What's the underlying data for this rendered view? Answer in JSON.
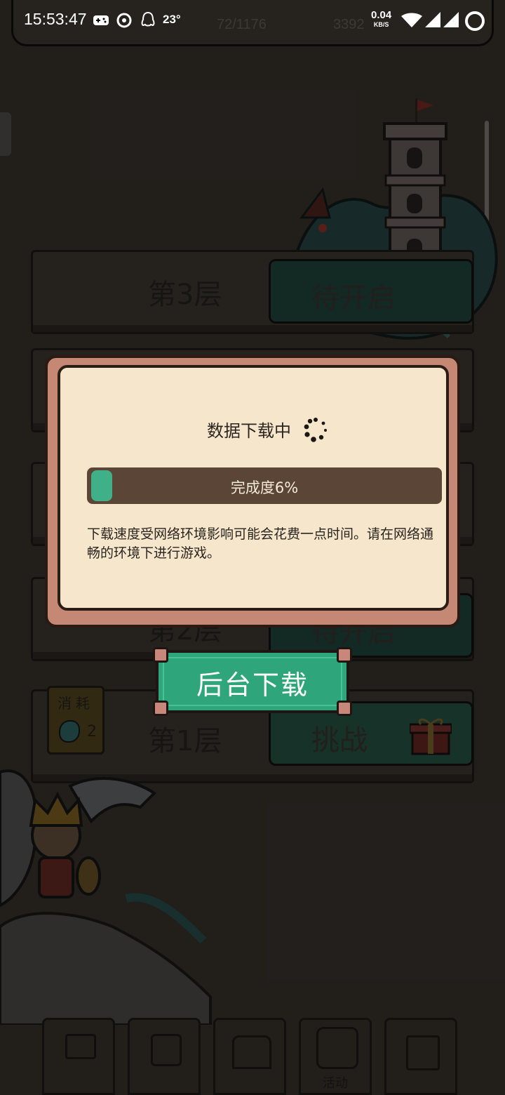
{
  "status_bar": {
    "time": "15:53:47",
    "temperature": "23°",
    "net_speed": "0.04",
    "net_speed_unit": "KB/S"
  },
  "hud": {
    "progress_count": "72/1176",
    "coins": "3392"
  },
  "floors": [
    {
      "name": "第3层",
      "action": "待开启"
    },
    {
      "name": "第2层",
      "action": "待开启"
    },
    {
      "name": "第1层",
      "action": "挑战",
      "cost_label": "消耗",
      "cost_value": "2"
    }
  ],
  "bottom_nav": {
    "items": [
      {
        "icon": "shop-cart-icon",
        "label": ""
      },
      {
        "icon": "hourglass-icon",
        "label": ""
      },
      {
        "icon": "castle-icon",
        "label": ""
      },
      {
        "icon": "event-icon",
        "label": "活动"
      },
      {
        "icon": "ranking-icon",
        "label": ""
      }
    ]
  },
  "modal": {
    "title": "数据下载中",
    "progress_percent": 6,
    "progress_label": "完成度6%",
    "description": "下载速度受网络环境影响可能会花费一点时间。请在网络通畅的环境下进行游戏。"
  },
  "background_download_button": {
    "label": "后台下载"
  },
  "colors": {
    "accent_green": "#3fb088",
    "panel_cream": "#f6e6cb",
    "frame_pink": "#c48874",
    "progress_track": "#5a4537"
  }
}
